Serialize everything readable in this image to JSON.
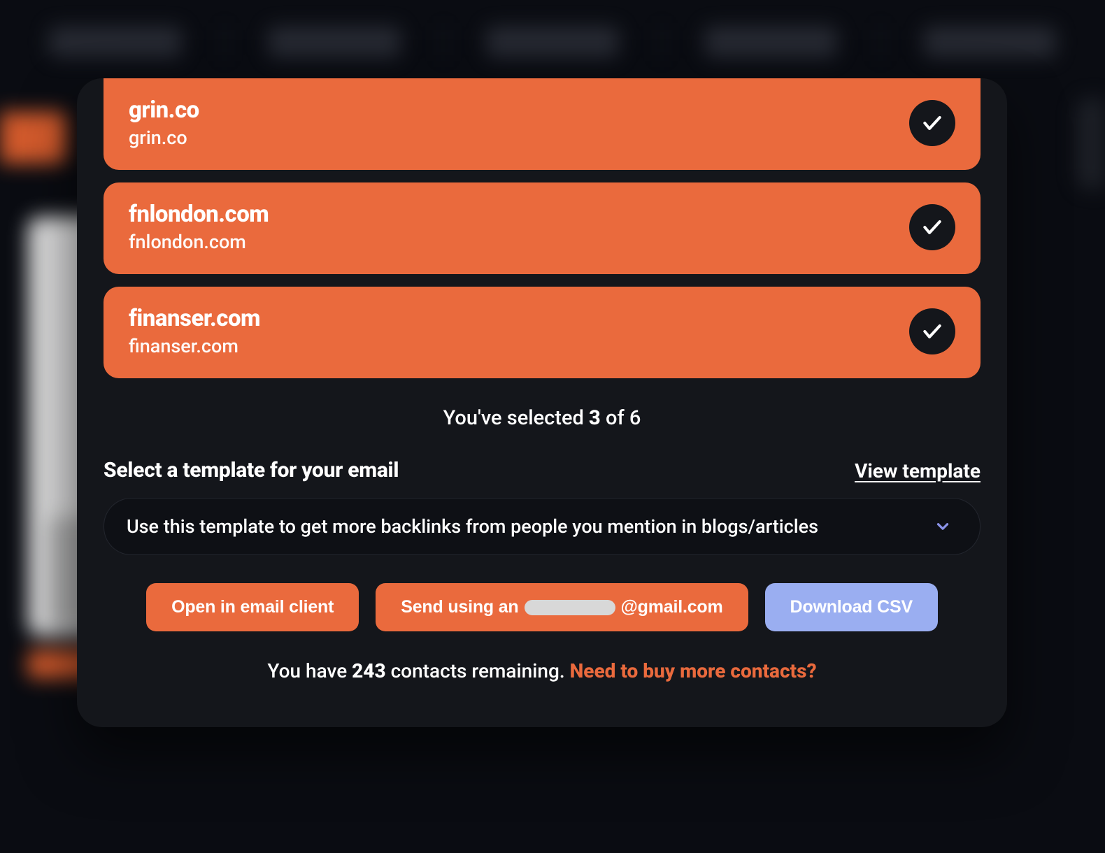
{
  "sites": [
    {
      "title": "grin.co",
      "sub": "grin.co",
      "selected": true
    },
    {
      "title": "fnlondon.com",
      "sub": "fnlondon.com",
      "selected": true
    },
    {
      "title": "finanser.com",
      "sub": "finanser.com",
      "selected": true
    }
  ],
  "selection": {
    "prefix": "You've selected ",
    "count": "3",
    "suffix": " of 6"
  },
  "template_section": {
    "heading": "Select a template for your email",
    "view_link": "View template",
    "dropdown_value": "Use this template to get more backlinks from people you mention in blogs/articles"
  },
  "buttons": {
    "open_client": "Open in email client",
    "send_prefix": "Send using an",
    "send_suffix": "@gmail.com",
    "download_csv": "Download CSV"
  },
  "remaining": {
    "prefix": "You have ",
    "count": "243",
    "mid": " contacts remaining. ",
    "buy_more": "Need to buy more contacts?"
  },
  "icons": {
    "check": "check-icon",
    "chevron": "chevron-down-icon"
  }
}
